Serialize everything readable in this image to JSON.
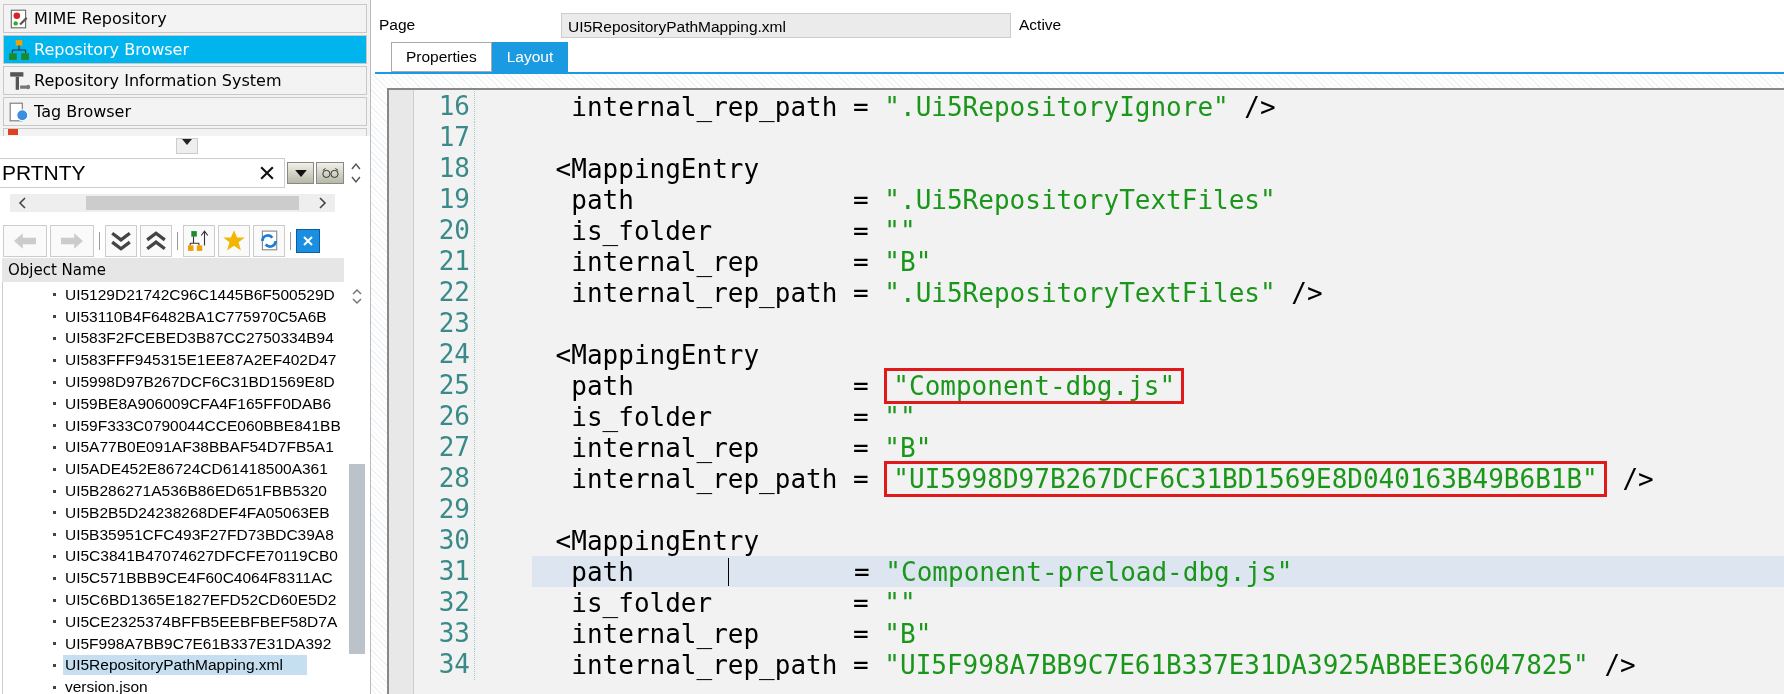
{
  "navigator": {
    "items": [
      {
        "label": "MIME Repository",
        "selected": false
      },
      {
        "label": "Repository Browser",
        "selected": true
      },
      {
        "label": "Repository Information System",
        "selected": false
      },
      {
        "label": "Tag Browser",
        "selected": false
      }
    ]
  },
  "search": {
    "value": "PRTNTY"
  },
  "object_list": {
    "header": "Object Name",
    "items": [
      {
        "label": "UI5129D21742C96C1445B6F500529D",
        "selected": false
      },
      {
        "label": "UI53110B4F6482BA1C775970C5A6B",
        "selected": false
      },
      {
        "label": "UI583F2FCEBED3B87CC2750334B94",
        "selected": false
      },
      {
        "label": "UI583FFF945315E1EE87A2EF402D47",
        "selected": false
      },
      {
        "label": "UI5998D97B267DCF6C31BD1569E8D",
        "selected": false
      },
      {
        "label": "UI59BE8A906009CFA4F165FF0DAB6",
        "selected": false
      },
      {
        "label": "UI59F333C0790044CCE060BBE841BB",
        "selected": false
      },
      {
        "label": "UI5A77B0E091AF38BBAF54D7FB5A1",
        "selected": false
      },
      {
        "label": "UI5ADE452E86724CD61418500A361",
        "selected": false
      },
      {
        "label": "UI5B286271A536B86ED651FBB5320",
        "selected": false
      },
      {
        "label": "UI5B2B5D24238268DEF4FA05063EB",
        "selected": false
      },
      {
        "label": "UI5B35951CFC493F27FD73BDC39A8",
        "selected": false
      },
      {
        "label": "UI5C3841B47074627DFCFE70119CB0",
        "selected": false
      },
      {
        "label": "UI5C571BBB9CE4F60C4064F8311AC",
        "selected": false
      },
      {
        "label": "UI5C6BD1365E1827EFD52CD60E5D2",
        "selected": false
      },
      {
        "label": "UI5CE2325374BFFB5EEBFBEF58D7A",
        "selected": false
      },
      {
        "label": "UI5F998A7BB9C7E61B337E31DA392",
        "selected": false
      },
      {
        "label": "UI5RepositoryPathMapping.xml",
        "selected": true
      },
      {
        "label": "version.json",
        "selected": false
      }
    ]
  },
  "page": {
    "label": "Page",
    "value": "UI5RepositoryPathMapping.xml",
    "status": "Active"
  },
  "tabs": [
    {
      "label": "Properties",
      "selected": false
    },
    {
      "label": "Layout",
      "selected": true
    }
  ],
  "editor": {
    "lines": [
      {
        "number": "16",
        "selected": false,
        "segments": [
          {
            "kind": "text",
            "text": "     internal_rep_path = "
          },
          {
            "kind": "string",
            "text": "\".Ui5RepositoryIgnore\""
          },
          {
            "kind": "text",
            "text": " />"
          }
        ]
      },
      {
        "number": "17",
        "selected": false
      },
      {
        "number": "18",
        "selected": false,
        "segments": [
          {
            "kind": "text",
            "text": "    <MappingEntry"
          }
        ]
      },
      {
        "number": "19",
        "selected": false,
        "segments": [
          {
            "kind": "text",
            "text": "     path              = "
          },
          {
            "kind": "string",
            "text": "\".Ui5RepositoryTextFiles\""
          }
        ]
      },
      {
        "number": "20",
        "selected": false,
        "segments": [
          {
            "kind": "text",
            "text": "     is_folder         = "
          },
          {
            "kind": "string",
            "text": "\"\""
          }
        ]
      },
      {
        "number": "21",
        "selected": false,
        "segments": [
          {
            "kind": "text",
            "text": "     internal_rep      = "
          },
          {
            "kind": "string",
            "text": "\"B\""
          }
        ]
      },
      {
        "number": "22",
        "selected": false,
        "segments": [
          {
            "kind": "text",
            "text": "     internal_rep_path = "
          },
          {
            "kind": "string",
            "text": "\".Ui5RepositoryTextFiles\""
          },
          {
            "kind": "text",
            "text": " />"
          }
        ]
      },
      {
        "number": "23",
        "selected": false
      },
      {
        "number": "24",
        "selected": false,
        "segments": [
          {
            "kind": "text",
            "text": "    <MappingEntry"
          }
        ]
      },
      {
        "number": "25",
        "selected": false,
        "segments": [
          {
            "kind": "text",
            "text": "     path              = "
          },
          {
            "kind": "string",
            "text": "\"Component-dbg.js\"",
            "boxed": true
          }
        ]
      },
      {
        "number": "26",
        "selected": false,
        "segments": [
          {
            "kind": "text",
            "text": "     is_folder         = "
          },
          {
            "kind": "string",
            "text": "\"\""
          }
        ]
      },
      {
        "number": "27",
        "selected": false,
        "segments": [
          {
            "kind": "text",
            "text": "     internal_rep      = "
          },
          {
            "kind": "string",
            "text": "\"B\""
          }
        ]
      },
      {
        "number": "28",
        "selected": false,
        "segments": [
          {
            "kind": "text",
            "text": "     internal_rep_path = "
          },
          {
            "kind": "string",
            "text": "\"UI5998D97B267DCF6C31BD1569E8D040163B49B6B1B\"",
            "boxed": true
          },
          {
            "kind": "text",
            "text": " />"
          }
        ]
      },
      {
        "number": "29",
        "selected": false
      },
      {
        "number": "30",
        "selected": false,
        "segments": [
          {
            "kind": "text",
            "text": "    <MappingEntry"
          }
        ]
      },
      {
        "number": "31",
        "selected": true,
        "segments": [
          {
            "kind": "text",
            "text": "     path      "
          },
          {
            "kind": "cursor"
          },
          {
            "kind": "text",
            "text": "        = "
          },
          {
            "kind": "string",
            "text": "\"Component-preload-dbg.js\""
          }
        ]
      },
      {
        "number": "32",
        "selected": false,
        "segments": [
          {
            "kind": "text",
            "text": "     is_folder         = "
          },
          {
            "kind": "string",
            "text": "\"\""
          }
        ]
      },
      {
        "number": "33",
        "selected": false,
        "segments": [
          {
            "kind": "text",
            "text": "     internal_rep      = "
          },
          {
            "kind": "string",
            "text": "\"B\""
          }
        ]
      },
      {
        "number": "34",
        "selected": false,
        "segments": [
          {
            "kind": "text",
            "text": "     internal_rep_path = "
          },
          {
            "kind": "string",
            "text": "\"UI5F998A7BB9C7E61B337E31DA3925ABBEE36047825\""
          },
          {
            "kind": "text",
            "text": " />"
          }
        ]
      }
    ]
  }
}
